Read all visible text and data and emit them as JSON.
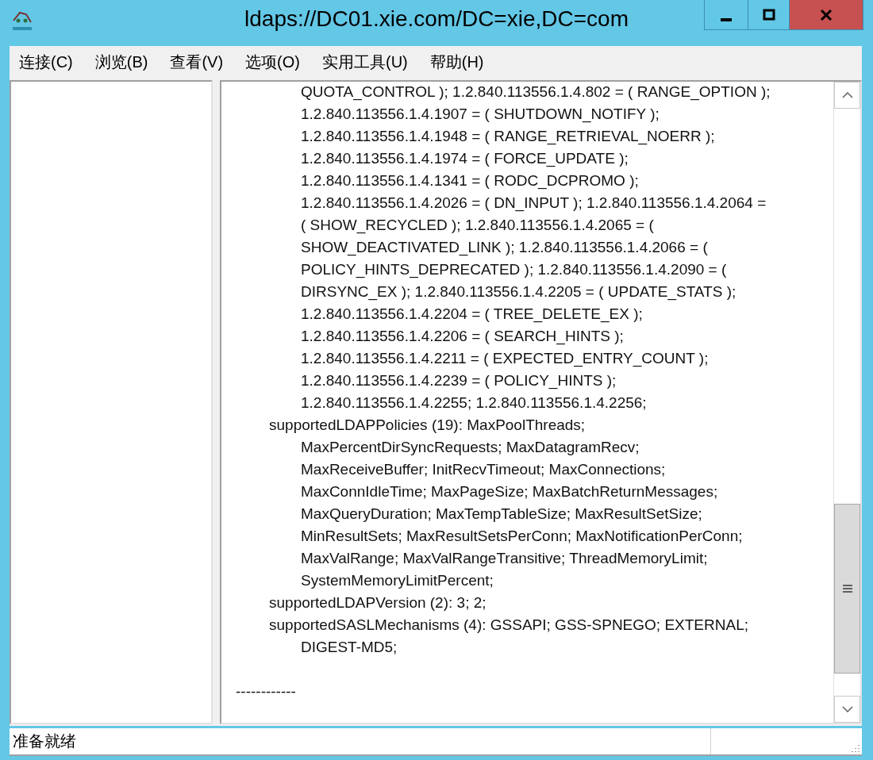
{
  "window": {
    "title": "ldaps://DC01.xie.com/DC=xie,DC=com"
  },
  "menu": [
    "连接(C)",
    "浏览(B)",
    "查看(V)",
    "选项(O)",
    "实用工具(U)",
    "帮助(H)"
  ],
  "content": {
    "attributes": [
      {
        "wrapped_lines": [
          "QUOTA_CONTROL ); 1.2.840.113556.1.4.802 = ( RANGE_OPTION );",
          "1.2.840.113556.1.4.1907 = ( SHUTDOWN_NOTIFY );",
          "1.2.840.113556.1.4.1948 = ( RANGE_RETRIEVAL_NOERR );",
          "1.2.840.113556.1.4.1974 = ( FORCE_UPDATE );",
          "1.2.840.113556.1.4.1341 = ( RODC_DCPROMO );",
          "1.2.840.113556.1.4.2026 = ( DN_INPUT ); 1.2.840.113556.1.4.2064 =",
          "( SHOW_RECYCLED ); 1.2.840.113556.1.4.2065 = (",
          "SHOW_DEACTIVATED_LINK ); 1.2.840.113556.1.4.2066 = (",
          "POLICY_HINTS_DEPRECATED ); 1.2.840.113556.1.4.2090 = (",
          "DIRSYNC_EX ); 1.2.840.113556.1.4.2205 = ( UPDATE_STATS );",
          "1.2.840.113556.1.4.2204 = ( TREE_DELETE_EX );",
          "1.2.840.113556.1.4.2206 = ( SEARCH_HINTS );",
          "1.2.840.113556.1.4.2211 = ( EXPECTED_ENTRY_COUNT );",
          "1.2.840.113556.1.4.2239 = ( POLICY_HINTS );",
          "1.2.840.113556.1.4.2255; 1.2.840.113556.1.4.2256;"
        ]
      },
      {
        "name_line": "supportedLDAPPolicies (19): MaxPoolThreads;",
        "wrapped_lines": [
          "MaxPercentDirSyncRequests; MaxDatagramRecv;",
          "MaxReceiveBuffer; InitRecvTimeout; MaxConnections;",
          "MaxConnIdleTime; MaxPageSize; MaxBatchReturnMessages;",
          "MaxQueryDuration; MaxTempTableSize; MaxResultSetSize;",
          "MinResultSets; MaxResultSetsPerConn; MaxNotificationPerConn;",
          "MaxValRange; MaxValRangeTransitive; ThreadMemoryLimit;",
          "SystemMemoryLimitPercent;"
        ]
      },
      {
        "name_line": "supportedLDAPVersion (2): 3; 2;"
      },
      {
        "name_line": "supportedSASLMechanisms (4): GSSAPI; GSS-SPNEGO; EXTERNAL;",
        "wrapped_lines": [
          "DIGEST-MD5;"
        ]
      }
    ],
    "separator": "------------"
  },
  "status_bar": {
    "text": "准备就绪"
  }
}
